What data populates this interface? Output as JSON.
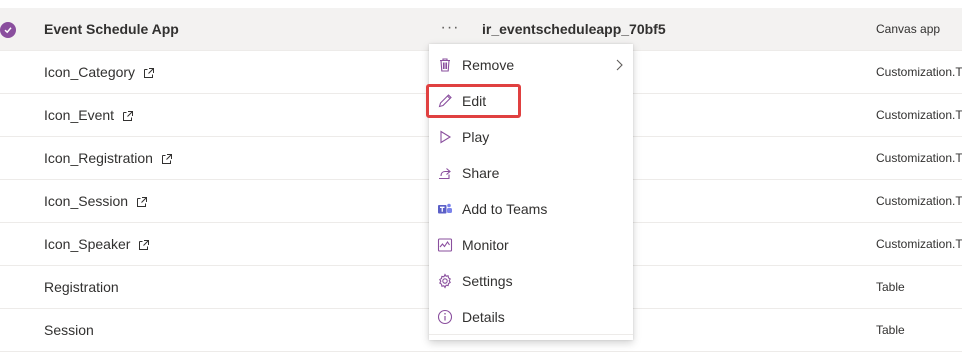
{
  "rows": [
    {
      "name": "Event Schedule App",
      "type": "Canvas app",
      "schema": "ir_eventscheduleapp_70bf5",
      "more": "···",
      "selected": true,
      "external": false
    },
    {
      "name": "Icon_Category",
      "type": "Customization.Ty",
      "external": true
    },
    {
      "name": "Icon_Event",
      "type": "Customization.Ty",
      "external": true
    },
    {
      "name": "Icon_Registration",
      "type": "Customization.Ty",
      "external": true
    },
    {
      "name": "Icon_Session",
      "type": "Customization.Ty",
      "external": true
    },
    {
      "name": "Icon_Speaker",
      "type": "Customization.Ty",
      "external": true
    },
    {
      "name": "Registration",
      "type": "Table",
      "external": false
    },
    {
      "name": "Session",
      "type": "Table",
      "external": false
    }
  ],
  "context_menu": {
    "items": [
      {
        "label": "Remove",
        "icon": "trash-icon",
        "has_submenu": true
      },
      {
        "label": "Edit",
        "icon": "pencil-icon",
        "highlighted": true
      },
      {
        "label": "Play",
        "icon": "play-icon"
      },
      {
        "label": "Share",
        "icon": "share-icon"
      },
      {
        "label": "Add to Teams",
        "icon": "teams-icon"
      },
      {
        "label": "Monitor",
        "icon": "monitor-icon"
      },
      {
        "label": "Settings",
        "icon": "gear-icon"
      },
      {
        "label": "Details",
        "icon": "info-icon"
      }
    ]
  },
  "colors": {
    "accent": "#8a4f9e",
    "highlight_border": "#e04040",
    "selected_row": "#f3f2f1"
  }
}
